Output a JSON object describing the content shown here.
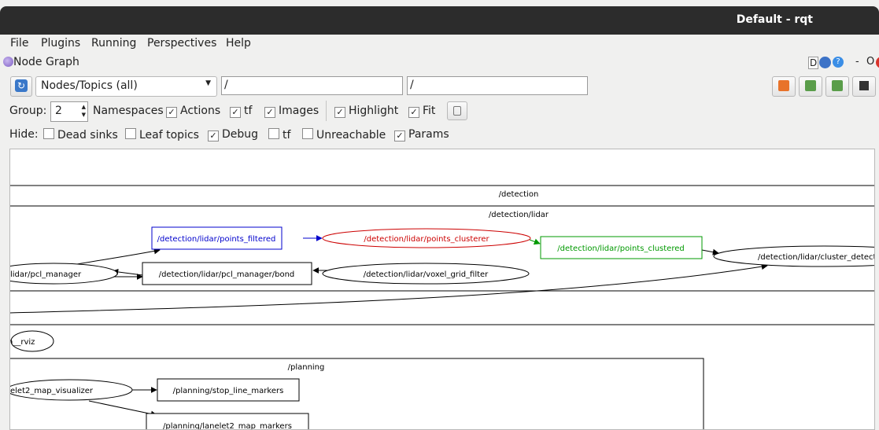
{
  "window": {
    "title": "Default - rqt"
  },
  "menu": {
    "file": "File",
    "plugins": "Plugins",
    "running": "Running",
    "perspectives": "Perspectives",
    "help": "Help"
  },
  "plugin": {
    "title": "Node Graph",
    "ctrl_d": "D",
    "ctrl_min": "-",
    "ctrl_o": "O"
  },
  "toolbar": {
    "mode": "Nodes/Topics (all)",
    "node_filter": "/",
    "topic_filter": "/"
  },
  "options": {
    "group_label": "Group:",
    "group_value": "2",
    "namespaces": "Namespaces",
    "actions": "Actions",
    "tf": "tf",
    "images": "Images",
    "highlight": "Highlight",
    "fit": "Fit"
  },
  "hide": {
    "label": "Hide:",
    "dead_sinks": "Dead sinks",
    "leaf_topics": "Leaf topics",
    "debug": "Debug",
    "tf": "tf",
    "unreachable": "Unreachable",
    "params": "Params"
  },
  "graph": {
    "clusters": {
      "detection": "/detection",
      "detection_lidar": "/detection/lidar",
      "planning": "/planning"
    },
    "nodes": {
      "points_filtered": "/detection/lidar/points_filtered",
      "points_clusterer": "/detection/lidar/points_clusterer",
      "points_clustered": "/detection/lidar/points_clustered",
      "cluster_detector": "/detection/lidar/cluster_detector",
      "pcl_manager": "lidar/pcl_manager",
      "pcl_manager_bond": "/detection/lidar/pcl_manager/bond",
      "voxel_grid_filter": "/detection/lidar/voxel_grid_filter",
      "rviz": "n__rviz",
      "lanelet2_map_visualizer": "elet2_map_visualizer",
      "stop_line_markers": "/planning/stop_line_markers",
      "lanelet2_map_markers": "/planning/lanelet2_map_markers"
    },
    "colors": {
      "blue": "#0000cc",
      "red": "#cc0000",
      "green": "#009900"
    }
  }
}
